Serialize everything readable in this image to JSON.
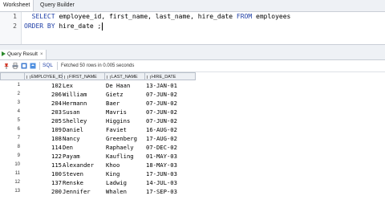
{
  "top_tabs": [
    "Worksheet",
    "Query Builder"
  ],
  "editor": {
    "lines": [
      {
        "num": "1",
        "segments": [
          {
            "t": "  "
          },
          {
            "t": "SELECT",
            "kw": true
          },
          {
            "t": " employee_id, first_name, last_name, hire_date "
          },
          {
            "t": "FROM",
            "kw": true
          },
          {
            "t": " employees"
          }
        ]
      },
      {
        "num": "2",
        "segments": [
          {
            "t": "ORDER BY",
            "kw": true
          },
          {
            "t": " hire_date ;"
          }
        ]
      }
    ]
  },
  "result_tab": {
    "label": "Query Result",
    "close": "×"
  },
  "toolbar": {
    "icons": [
      "pin-icon",
      "print-icon",
      "export-icon",
      "refresh-icon"
    ],
    "sql_label": "SQL",
    "message": "Fetched 50 rows in 0.005 seconds"
  },
  "grid": {
    "columns": [
      "EMPLOYEE_ID",
      "FIRST_NAME",
      "LAST_NAME",
      "HIRE_DATE"
    ],
    "rows": [
      [
        "1",
        "102",
        "Lex",
        "De Haan",
        "13-JAN-01"
      ],
      [
        "2",
        "206",
        "William",
        "Gietz",
        "07-JUN-02"
      ],
      [
        "3",
        "204",
        "Hermann",
        "Baer",
        "07-JUN-02"
      ],
      [
        "4",
        "203",
        "Susan",
        "Mavris",
        "07-JUN-02"
      ],
      [
        "5",
        "205",
        "Shelley",
        "Higgins",
        "07-JUN-02"
      ],
      [
        "6",
        "109",
        "Daniel",
        "Faviet",
        "16-AUG-02"
      ],
      [
        "7",
        "108",
        "Nancy",
        "Greenberg",
        "17-AUG-02"
      ],
      [
        "8",
        "114",
        "Den",
        "Raphaely",
        "07-DEC-02"
      ],
      [
        "9",
        "122",
        "Payam",
        "Kaufling",
        "01-MAY-03"
      ],
      [
        "10",
        "115",
        "Alexander",
        "Khoo",
        "18-MAY-03"
      ],
      [
        "11",
        "100",
        "Steven",
        "King",
        "17-JUN-03"
      ],
      [
        "12",
        "137",
        "Renske",
        "Ladwig",
        "14-JUL-03"
      ],
      [
        "13",
        "200",
        "Jennifer",
        "Whalen",
        "17-SEP-03"
      ]
    ]
  },
  "colors": {
    "keyword": "#1f3fa6",
    "run_icon": "#2d8a2d"
  }
}
